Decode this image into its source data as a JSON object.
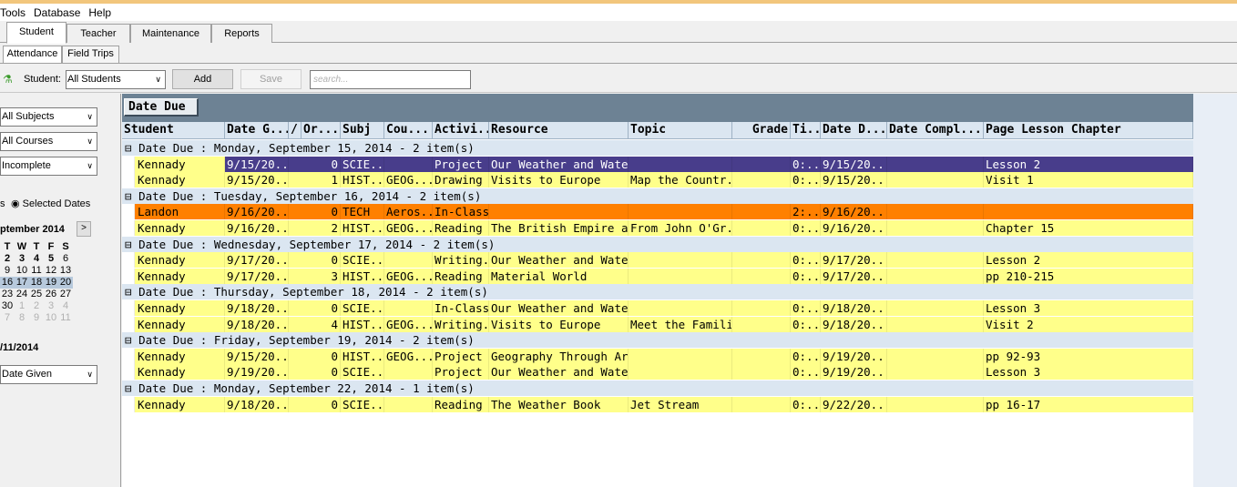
{
  "menu": {
    "items": [
      "Tools",
      "Database",
      "Help"
    ]
  },
  "main_tabs": [
    "Student",
    "Teacher",
    "Maintenance",
    "Reports"
  ],
  "sub_tabs": [
    "Attendance",
    "Field Trips"
  ],
  "toolbar": {
    "student_label": "Student:",
    "student_value": "All Students",
    "add_label": "Add",
    "save_label": "Save",
    "search_placeholder": "search..."
  },
  "filters": {
    "subjects": "All Subjects",
    "courses": "All Courses",
    "status": "Incomplete",
    "date_field": "Date Given"
  },
  "dates": {
    "radio_partial": "s",
    "radio_selected": "Selected Dates",
    "month_label": "ptember 2014",
    "next": ">",
    "footer_date": "/11/2014",
    "dow": [
      "T",
      "W",
      "T",
      "F",
      "S"
    ],
    "weeks": [
      [
        "2",
        "3",
        "4",
        "5",
        "6"
      ],
      [
        "9",
        "10",
        "11",
        "12",
        "13"
      ],
      [
        "16",
        "17",
        "18",
        "19",
        "20"
      ],
      [
        "23",
        "24",
        "25",
        "26",
        "27"
      ],
      [
        "30",
        "1",
        "2",
        "3",
        "4"
      ],
      [
        "7",
        "8",
        "9",
        "10",
        "11"
      ]
    ]
  },
  "grid": {
    "group_chip": "Date Due",
    "columns": [
      "Student",
      "Date G...",
      "/",
      "Or...",
      "Subj",
      "Cou...",
      "Activi...",
      "Resource",
      "Topic",
      "Grade",
      "Ti...",
      "Date D...",
      "Date Compl...",
      "Page Lesson Chapter"
    ],
    "groups": [
      {
        "label": "Date Due : Monday, September 15, 2014 - 2 item(s)",
        "rows": [
          {
            "student": "Kennady",
            "date_given": "9/15/20...",
            "order": "0",
            "subj": "SCIE...",
            "course": "",
            "activity": "Project",
            "resource": "Our Weather and Water",
            "topic": "",
            "grade": "",
            "time": "0:...",
            "date_due": "9/15/20...",
            "date_completed": "",
            "page": "Lesson 2",
            "style": "selected"
          },
          {
            "student": "Kennady",
            "date_given": "9/15/20...",
            "order": "1",
            "subj": "HIST...",
            "course": "GEOG...",
            "activity": "Drawing",
            "resource": "Visits to Europe",
            "topic": "Map the Countr...",
            "grade": "",
            "time": "0:...",
            "date_due": "9/15/20...",
            "date_completed": "",
            "page": "Visit 1",
            "style": "yellow"
          }
        ]
      },
      {
        "label": "Date Due : Tuesday, September 16, 2014 - 2 item(s)",
        "rows": [
          {
            "student": "Landon",
            "date_given": "9/16/20...",
            "order": "0",
            "subj": "TECH",
            "course": "Aeros...",
            "activity": "In-Class",
            "resource": "",
            "topic": "",
            "grade": "",
            "time": "2:...",
            "date_due": "9/16/20...",
            "date_completed": "",
            "page": "",
            "style": "orange"
          },
          {
            "student": "Kennady",
            "date_given": "9/16/20...",
            "order": "2",
            "subj": "HIST...",
            "course": "GEOG...",
            "activity": "Reading",
            "resource": "The British Empire an...",
            "topic": "From John O'Gr...",
            "grade": "",
            "time": "0:...",
            "date_due": "9/16/20...",
            "date_completed": "",
            "page": "Chapter 15",
            "style": "yellow"
          }
        ]
      },
      {
        "label": "Date Due : Wednesday, September 17, 2014 - 2 item(s)",
        "rows": [
          {
            "student": "Kennady",
            "date_given": "9/17/20...",
            "order": "0",
            "subj": "SCIE...",
            "course": "",
            "activity": "Writing...",
            "resource": "Our Weather and Water",
            "topic": "",
            "grade": "",
            "time": "0:...",
            "date_due": "9/17/20...",
            "date_completed": "",
            "page": "Lesson 2",
            "style": "yellow"
          },
          {
            "student": "Kennady",
            "date_given": "9/17/20...",
            "order": "3",
            "subj": "HIST...",
            "course": "GEOG...",
            "activity": "Reading",
            "resource": "Material World",
            "topic": "",
            "grade": "",
            "time": "0:...",
            "date_due": "9/17/20...",
            "date_completed": "",
            "page": "pp 210-215",
            "style": "yellow"
          }
        ]
      },
      {
        "label": "Date Due : Thursday, September 18, 2014 - 2 item(s)",
        "rows": [
          {
            "student": "Kennady",
            "date_given": "9/18/20...",
            "order": "0",
            "subj": "SCIE...",
            "course": "",
            "activity": "In-Class",
            "resource": "Our Weather and Water",
            "topic": "",
            "grade": "",
            "time": "0:...",
            "date_due": "9/18/20...",
            "date_completed": "",
            "page": "Lesson 3",
            "style": "yellow"
          },
          {
            "student": "Kennady",
            "date_given": "9/18/20...",
            "order": "4",
            "subj": "HIST...",
            "course": "GEOG...",
            "activity": "Writing...",
            "resource": "Visits to Europe",
            "topic": "Meet the Famili...",
            "grade": "",
            "time": "0:...",
            "date_due": "9/18/20...",
            "date_completed": "",
            "page": "Visit 2",
            "style": "yellow"
          }
        ]
      },
      {
        "label": "Date Due : Friday, September 19, 2014 - 2 item(s)",
        "rows": [
          {
            "student": "Kennady",
            "date_given": "9/15/20...",
            "order": "0",
            "subj": "HIST...",
            "course": "GEOG...",
            "activity": "Project",
            "resource": "Geography Through Art",
            "topic": "",
            "grade": "",
            "time": "0:...",
            "date_due": "9/19/20...",
            "date_completed": "",
            "page": "pp 92-93",
            "style": "yellow"
          },
          {
            "student": "Kennady",
            "date_given": "9/19/20...",
            "order": "0",
            "subj": "SCIE...",
            "course": "",
            "activity": "Project",
            "resource": "Our Weather and Water",
            "topic": "",
            "grade": "",
            "time": "0:...",
            "date_due": "9/19/20...",
            "date_completed": "",
            "page": "Lesson 3",
            "style": "yellow"
          }
        ]
      },
      {
        "label": "Date Due : Monday, September 22, 2014 - 1 item(s)",
        "rows": [
          {
            "student": "Kennady",
            "date_given": "9/18/20...",
            "order": "0",
            "subj": "SCIE...",
            "course": "",
            "activity": "Reading",
            "resource": "The Weather Book",
            "topic": "Jet Stream",
            "grade": "",
            "time": "0:...",
            "date_due": "9/22/20...",
            "date_completed": "",
            "page": "pp 16-17",
            "style": "yellow"
          }
        ]
      }
    ]
  },
  "colors": {
    "row_yellow": "#ffff8a",
    "row_selected": "#483d8b",
    "row_orange": "#ff8000",
    "group_bar": "#6d8294"
  }
}
